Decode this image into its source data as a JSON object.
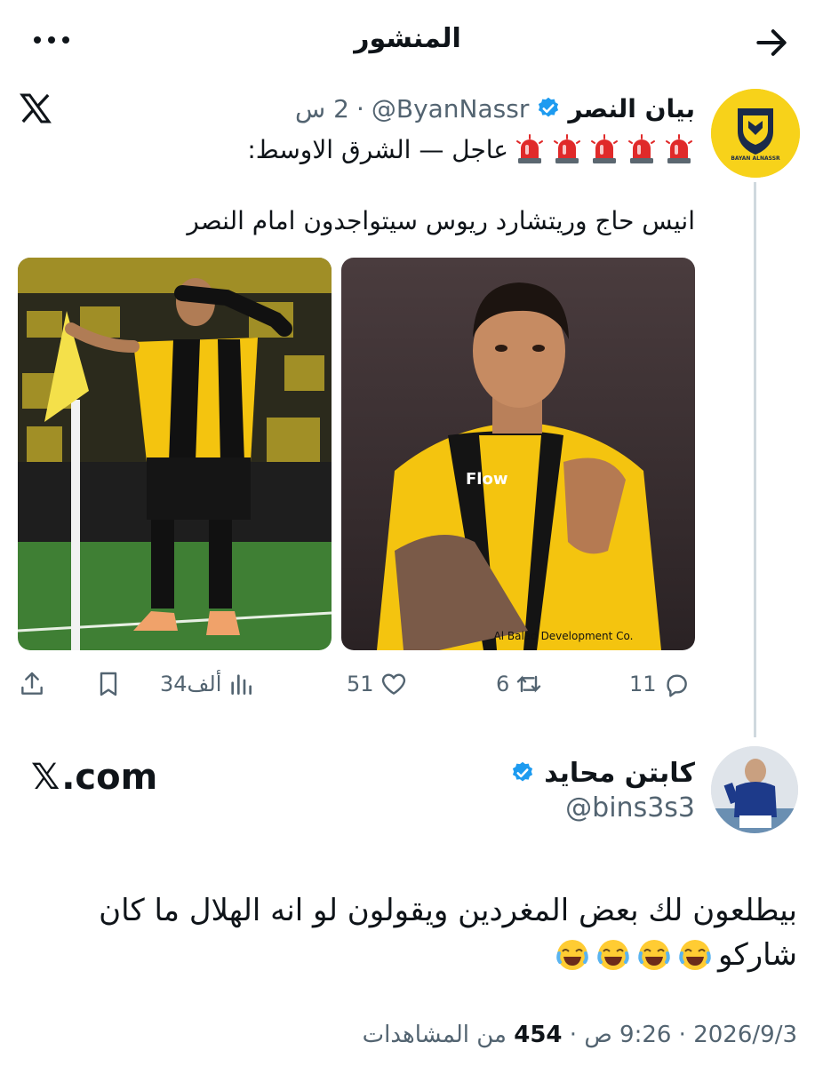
{
  "header": {
    "title": "المنشور"
  },
  "quoted": {
    "author_name": "بيان النصر",
    "handle": "@ByanNassr",
    "separator": "·",
    "time": "2 س",
    "headline": "عاجل — الشرق الاوسط:",
    "text": "انيس حاج وريتشارد ريوس سيتواجدون امام النصر",
    "avatar_text": "BAYAN ALNASSR",
    "actions": {
      "replies": "11",
      "reposts": "6",
      "likes": "51",
      "views": "34ألف"
    }
  },
  "main_post": {
    "author_name": "كابتن محايد",
    "handle": "@bins3s3",
    "brand_x": "𝕏",
    "brand_com": ".com",
    "text_line1": "بيطلعون لك بعض المغردين ويقولون لو انه الهلال ما كان",
    "text_line2": "شاركو",
    "meta_date": "2026/9/3 · 9:26 ص ·",
    "meta_views": "454",
    "meta_views_label": "من المشاهدات"
  },
  "colors": {
    "text": "#0f1419",
    "muted": "#536471",
    "verified": "#1d9bf0",
    "divider": "#cfd9de",
    "ittihad_yellow": "#f7d21a",
    "ittihad_black": "#111111"
  },
  "icons": [
    "more-icon",
    "back-arrow-icon",
    "x-logo-icon",
    "verified-icon",
    "siren-icon",
    "reply-icon",
    "repost-icon",
    "like-icon",
    "views-icon",
    "bookmark-icon",
    "share-icon",
    "laugh-emoji-icon"
  ]
}
